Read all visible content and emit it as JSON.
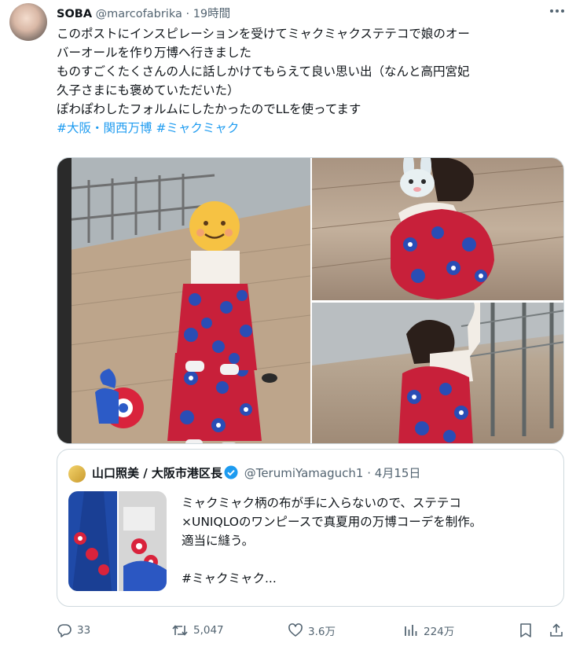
{
  "post": {
    "author_name": "SOBA",
    "author_handle": "@marcofabrika",
    "separator": "·",
    "time": "19時間",
    "text_lines": [
      "このポストにインスピレーションを受けてミャクミャクステテコで娘のオー",
      "バーオールを作り万博へ行きました",
      "ものすごくたくさんの人に話しかけてもらえて良い思い出（なんと高円宮妃",
      "久子さまにも褒めていただいた）",
      "ぽわぽわしたフォルムにしたかったのでLLを使ってます"
    ],
    "hashtags": [
      "#大阪・関西万博",
      "#ミャクミャク"
    ]
  },
  "quoted": {
    "author_name": "山口照美 / 大阪市港区長",
    "author_handle": "@TerumiYamaguch1",
    "separator": "·",
    "date": "4月15日",
    "text_lines": [
      "ミャクミャク柄の布が手に入らないので、ステテコ",
      "×UNIQLOのワンピースで真夏用の万博コーデを制作。",
      "適当に縫う。",
      "",
      "#ミャクミャク..."
    ]
  },
  "actions": {
    "replies": "33",
    "reposts": "5,047",
    "likes": "3.6万",
    "views": "224万"
  },
  "colors": {
    "text": "#0f1419",
    "muted": "#536471",
    "link": "#1d9bf0",
    "border": "#cfd9de"
  },
  "icons": [
    "more-icon",
    "reply-icon",
    "repost-icon",
    "like-icon",
    "views-icon",
    "bookmark-icon",
    "share-icon",
    "verified-badge-icon"
  ]
}
